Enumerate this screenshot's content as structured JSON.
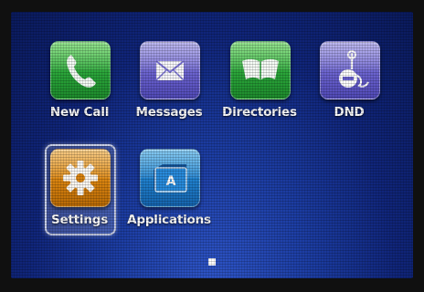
{
  "apps": [
    {
      "label": "New Call",
      "icon": "phone-icon",
      "color": "#2aa53a"
    },
    {
      "label": "Messages",
      "icon": "envelope-icon",
      "color": "#6b63cf"
    },
    {
      "label": "Directories",
      "icon": "open-book-icon",
      "color": "#2aa53a"
    },
    {
      "label": "DND",
      "icon": "do-not-disturb-icon",
      "color": "#6b63cf"
    },
    {
      "label": "Settings",
      "icon": "gear-icon",
      "color": "#da8410",
      "selected": true
    },
    {
      "label": "Applications",
      "icon": "applications-folder-icon",
      "color": "#1f7fcd"
    }
  ],
  "applications_icon_letter": "A",
  "pager": {
    "current_page": 1,
    "page_count": 1
  }
}
